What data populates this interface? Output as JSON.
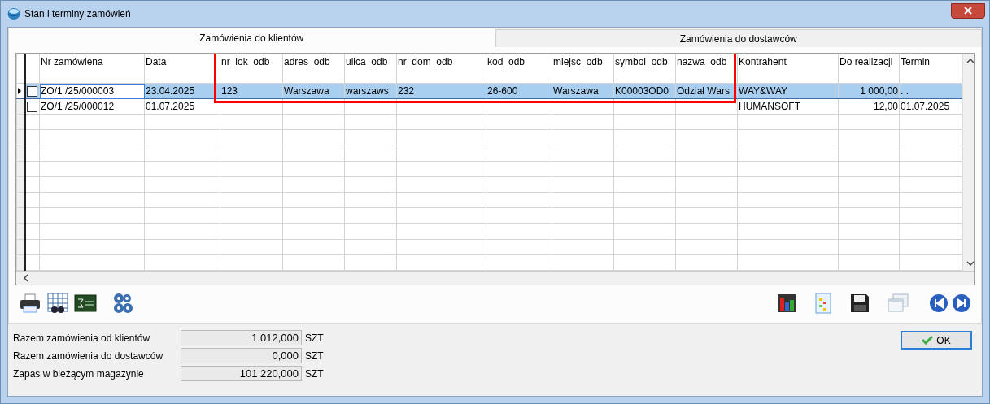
{
  "window": {
    "title": "Stan i terminy zamówień"
  },
  "tabs": [
    {
      "label": "Zamówienia do klientów",
      "selected": true
    },
    {
      "label": "Zamówienia do dostawców",
      "selected": false
    }
  ],
  "table": {
    "columns": [
      {
        "label": "Nr zamówiena",
        "kind": "text"
      },
      {
        "label": "Data",
        "kind": "text"
      },
      {
        "label": "nr_lok_odb",
        "kind": "text"
      },
      {
        "label": "adres_odb",
        "kind": "text"
      },
      {
        "label": "ulica_odb",
        "kind": "text"
      },
      {
        "label": "nr_dom_odb",
        "kind": "text"
      },
      {
        "label": "kod_odb",
        "kind": "text"
      },
      {
        "label": "miejsc_odb",
        "kind": "text"
      },
      {
        "label": "symbol_odb",
        "kind": "text"
      },
      {
        "label": "nazwa_odb",
        "kind": "text"
      },
      {
        "label": "Kontrahent",
        "kind": "text"
      },
      {
        "label": "Do realizacji",
        "kind": "number"
      },
      {
        "label": "Termin",
        "kind": "text"
      }
    ],
    "rows": [
      {
        "selected": true,
        "checked": false,
        "cells": [
          "ZO/1  /25/000003",
          "23.04.2025",
          "123",
          "Warszawa",
          "warszaws",
          "232",
          "26-600",
          "Warszawa",
          "K00003OD0",
          "Odział Wars",
          "WAY&WAY",
          "1 000,00",
          ". ."
        ]
      },
      {
        "selected": false,
        "checked": false,
        "cells": [
          "ZO/1  /25/000012",
          "01.07.2025",
          "",
          "",
          "",
          "",
          "",
          "",
          "",
          "",
          "HUMANSOFT",
          "12,00",
          "01.07.2025"
        ]
      }
    ]
  },
  "summary": [
    {
      "label": "Razem zamówienia od klientów",
      "value": "1 012,000",
      "unit": "SZT"
    },
    {
      "label": "Razem zamówienia do dostawców",
      "value": "0,000",
      "unit": "SZT"
    },
    {
      "label": "Zapas w bieżącym magazynie",
      "value": "101 220,000",
      "unit": "SZT"
    }
  ],
  "buttons": {
    "ok": "OK"
  }
}
